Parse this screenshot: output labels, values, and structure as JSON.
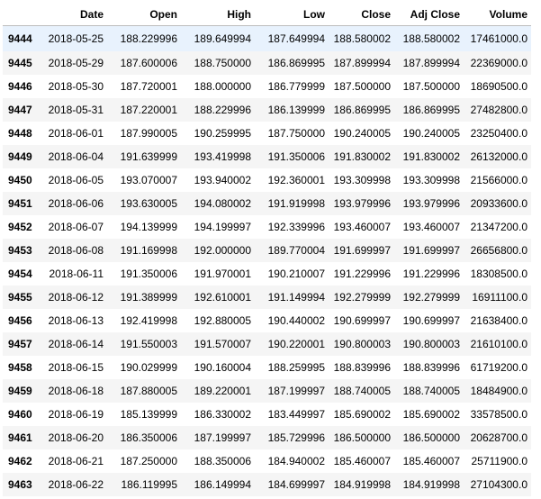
{
  "table": {
    "index_header": "",
    "columns": [
      "Date",
      "Open",
      "High",
      "Low",
      "Close",
      "Adj Close",
      "Volume"
    ],
    "rows": [
      {
        "index": "9444",
        "cells": [
          "2018-05-25",
          "188.229996",
          "189.649994",
          "187.649994",
          "188.580002",
          "188.580002",
          "17461000.0"
        ]
      },
      {
        "index": "9445",
        "cells": [
          "2018-05-29",
          "187.600006",
          "188.750000",
          "186.869995",
          "187.899994",
          "187.899994",
          "22369000.0"
        ]
      },
      {
        "index": "9446",
        "cells": [
          "2018-05-30",
          "187.720001",
          "188.000000",
          "186.779999",
          "187.500000",
          "187.500000",
          "18690500.0"
        ]
      },
      {
        "index": "9447",
        "cells": [
          "2018-05-31",
          "187.220001",
          "188.229996",
          "186.139999",
          "186.869995",
          "186.869995",
          "27482800.0"
        ]
      },
      {
        "index": "9448",
        "cells": [
          "2018-06-01",
          "187.990005",
          "190.259995",
          "187.750000",
          "190.240005",
          "190.240005",
          "23250400.0"
        ]
      },
      {
        "index": "9449",
        "cells": [
          "2018-06-04",
          "191.639999",
          "193.419998",
          "191.350006",
          "191.830002",
          "191.830002",
          "26132000.0"
        ]
      },
      {
        "index": "9450",
        "cells": [
          "2018-06-05",
          "193.070007",
          "193.940002",
          "192.360001",
          "193.309998",
          "193.309998",
          "21566000.0"
        ]
      },
      {
        "index": "9451",
        "cells": [
          "2018-06-06",
          "193.630005",
          "194.080002",
          "191.919998",
          "193.979996",
          "193.979996",
          "20933600.0"
        ]
      },
      {
        "index": "9452",
        "cells": [
          "2018-06-07",
          "194.139999",
          "194.199997",
          "192.339996",
          "193.460007",
          "193.460007",
          "21347200.0"
        ]
      },
      {
        "index": "9453",
        "cells": [
          "2018-06-08",
          "191.169998",
          "192.000000",
          "189.770004",
          "191.699997",
          "191.699997",
          "26656800.0"
        ]
      },
      {
        "index": "9454",
        "cells": [
          "2018-06-11",
          "191.350006",
          "191.970001",
          "190.210007",
          "191.229996",
          "191.229996",
          "18308500.0"
        ]
      },
      {
        "index": "9455",
        "cells": [
          "2018-06-12",
          "191.389999",
          "192.610001",
          "191.149994",
          "192.279999",
          "192.279999",
          "16911100.0"
        ]
      },
      {
        "index": "9456",
        "cells": [
          "2018-06-13",
          "192.419998",
          "192.880005",
          "190.440002",
          "190.699997",
          "190.699997",
          "21638400.0"
        ]
      },
      {
        "index": "9457",
        "cells": [
          "2018-06-14",
          "191.550003",
          "191.570007",
          "190.220001",
          "190.800003",
          "190.800003",
          "21610100.0"
        ]
      },
      {
        "index": "9458",
        "cells": [
          "2018-06-15",
          "190.029999",
          "190.160004",
          "188.259995",
          "188.839996",
          "188.839996",
          "61719200.0"
        ]
      },
      {
        "index": "9459",
        "cells": [
          "2018-06-18",
          "187.880005",
          "189.220001",
          "187.199997",
          "188.740005",
          "188.740005",
          "18484900.0"
        ]
      },
      {
        "index": "9460",
        "cells": [
          "2018-06-19",
          "185.139999",
          "186.330002",
          "183.449997",
          "185.690002",
          "185.690002",
          "33578500.0"
        ]
      },
      {
        "index": "9461",
        "cells": [
          "2018-06-20",
          "186.350006",
          "187.199997",
          "185.729996",
          "186.500000",
          "186.500000",
          "20628700.0"
        ]
      },
      {
        "index": "9462",
        "cells": [
          "2018-06-21",
          "187.250000",
          "188.350006",
          "184.940002",
          "185.460007",
          "185.460007",
          "25711900.0"
        ]
      },
      {
        "index": "9463",
        "cells": [
          "2018-06-22",
          "186.119995",
          "186.149994",
          "184.699997",
          "184.919998",
          "184.919998",
          "27104300.0"
        ]
      }
    ]
  },
  "style": {
    "highlight_row_color": "#e8f2fd",
    "stripe_row_color": "#f5f5f5",
    "header_border_color": "#bdbdbd"
  }
}
